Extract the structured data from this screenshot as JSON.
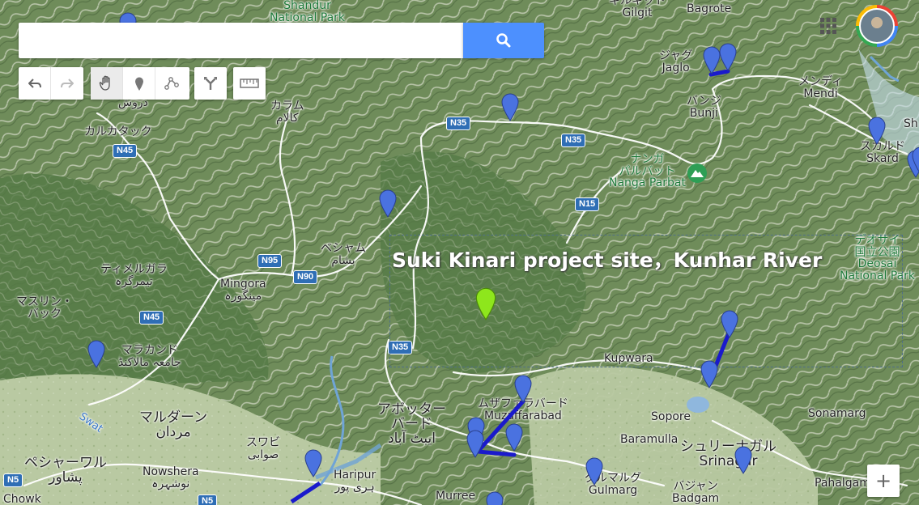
{
  "search": {
    "value": "",
    "placeholder": ""
  },
  "toolbar": {
    "history": [
      {
        "icon": "undo-icon"
      },
      {
        "icon": "redo-icon"
      }
    ],
    "tools": [
      {
        "icon": "hand-icon"
      },
      {
        "icon": "marker-icon"
      },
      {
        "icon": "line-icon"
      }
    ],
    "directions": {
      "icon": "directions-icon"
    },
    "measure": {
      "icon": "ruler-icon"
    }
  },
  "selection_label": "Suki Kinari project site，Kunhar River",
  "zoom_in_label": "+",
  "colors": {
    "pin_blue": "#4a72e0",
    "pin_green": "#8ee61c",
    "route": "#1a1acc",
    "search_button": "#4d90fe",
    "road_shield": "#2f6eb5"
  },
  "roads": [
    {
      "label": "N35"
    },
    {
      "label": "N35"
    },
    {
      "label": "N45"
    },
    {
      "label": "N95"
    },
    {
      "label": "N90"
    },
    {
      "label": "N15"
    },
    {
      "label": "N45"
    },
    {
      "label": "N35"
    },
    {
      "label": "N5"
    },
    {
      "label": "N5"
    }
  ],
  "places": [
    {
      "text": "Shandur\nNational Park",
      "style": "green"
    },
    {
      "text": "ギルギット\nGilgit",
      "style": ""
    },
    {
      "text": "Bagrote",
      "style": ""
    },
    {
      "text": "ジャグ\nJaglo",
      "style": ""
    },
    {
      "text": "バンジ\nBunji",
      "style": ""
    },
    {
      "text": "メンディ\nMendi",
      "style": ""
    },
    {
      "text": "スカルド\nSkard",
      "style": ""
    },
    {
      "text": "Sh",
      "style": ""
    },
    {
      "text": "دروش",
      "style": ""
    },
    {
      "text": "カラム\nکالام",
      "style": ""
    },
    {
      "text": "カルカタック",
      "style": ""
    },
    {
      "text": "ナンガ\nパルバット\nNanga Parbat",
      "style": "green"
    },
    {
      "text": "ベシャム\nبشام",
      "style": ""
    },
    {
      "text": "デオサイ\n国立公園\nDeosai\nNational Park",
      "style": "green"
    },
    {
      "text": "ティメルガラ\nتیمرگرہ",
      "style": ""
    },
    {
      "text": "Mingora\nمینگورہ",
      "style": ""
    },
    {
      "text": "マスリン・\nバック",
      "style": ""
    },
    {
      "text": "マラカンド\nجامعہ مالاکنڈ",
      "style": ""
    },
    {
      "text": "Kupwara",
      "style": ""
    },
    {
      "text": "アボッター\nバード\nایبٹ آباد",
      "style": "big"
    },
    {
      "text": "ムザファラバード\nMuzaffarabad",
      "style": ""
    },
    {
      "text": "Sopore",
      "style": ""
    },
    {
      "text": "Sonamarg",
      "style": ""
    },
    {
      "text": "Baramulla",
      "style": ""
    },
    {
      "text": "シュリーナガル\nSrinagar",
      "style": "big"
    },
    {
      "text": "マルダーン\nمردان",
      "style": "big"
    },
    {
      "text": "スワビ\nصوابی",
      "style": ""
    },
    {
      "text": "ペシャーワル\nپشاور",
      "style": "big"
    },
    {
      "text": "Nowshera\nنوشہرہ",
      "style": ""
    },
    {
      "text": "Haripur\nہری پور",
      "style": ""
    },
    {
      "text": "Murree",
      "style": ""
    },
    {
      "text": "グルマルグ\nGulmarg",
      "style": ""
    },
    {
      "text": "バジャン\nBadgam",
      "style": ""
    },
    {
      "text": "Pahalgam",
      "style": ""
    },
    {
      "text": "Chowk",
      "style": ""
    },
    {
      "text": "Swat",
      "style": "water"
    }
  ],
  "markers": [
    {
      "color": "blue"
    },
    {
      "color": "blue"
    },
    {
      "color": "blue"
    },
    {
      "color": "blue"
    },
    {
      "color": "blue"
    },
    {
      "color": "blue"
    },
    {
      "color": "blue"
    },
    {
      "color": "green"
    },
    {
      "color": "blue"
    },
    {
      "color": "blue"
    },
    {
      "color": "blue"
    },
    {
      "color": "blue"
    },
    {
      "color": "blue"
    },
    {
      "color": "blue"
    },
    {
      "color": "blue"
    },
    {
      "color": "blue"
    },
    {
      "color": "blue"
    },
    {
      "color": "blue"
    },
    {
      "color": "blue"
    },
    {
      "color": "blue"
    }
  ],
  "icons": {
    "search": "search-icon",
    "apps": "apps-grid-icon",
    "avatar": "account-avatar",
    "peak": "mountain-peak-icon"
  }
}
